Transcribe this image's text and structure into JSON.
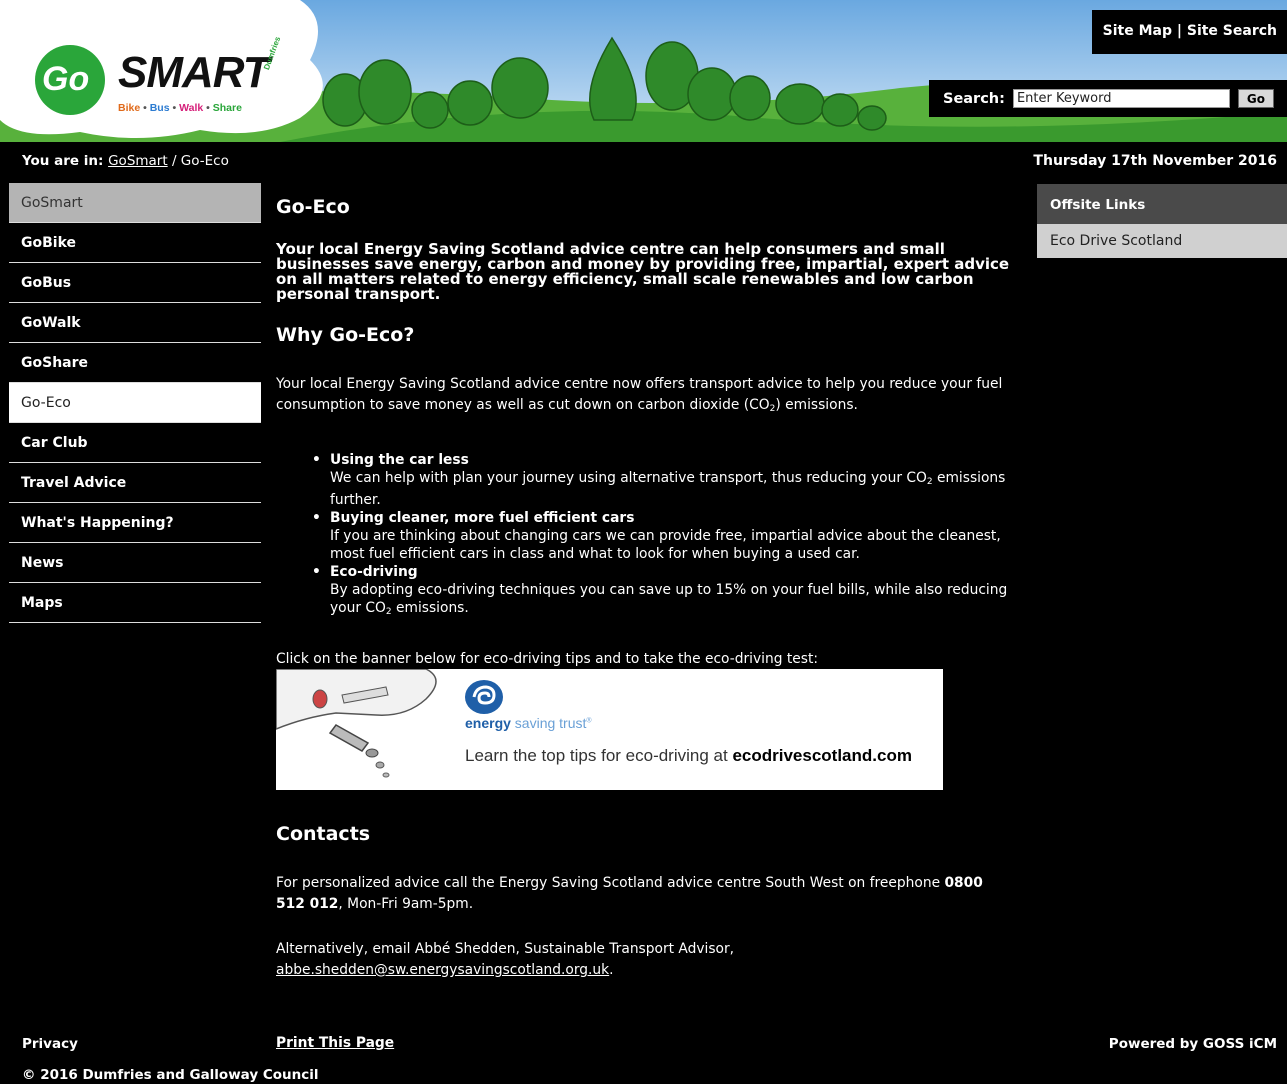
{
  "header": {
    "logo_go": "Go",
    "logo_smart": "SMART",
    "logo_suffix": "Dumfries",
    "logo_tagline_bike": "Bike",
    "logo_tagline_bus": "Bus",
    "logo_tagline_walk": "Walk",
    "logo_tagline_share": "Share",
    "top_links": [
      "Site Map",
      "Site Search"
    ],
    "top_links_sep": " | ",
    "search_label": "Search:",
    "search_placeholder": "Enter Keyword",
    "search_button": "Go"
  },
  "breadcrumb": {
    "prefix": "You are in:",
    "parent": "GoSmart",
    "sep": " / ",
    "current": "Go-Eco"
  },
  "date": "Thursday 17th November 2016",
  "leftnav": [
    "GoSmart",
    "GoBike",
    "GoBus",
    "GoWalk",
    "GoShare",
    "Go-Eco",
    "Car Club",
    "Travel Advice",
    "What's Happening?",
    "News",
    "Maps"
  ],
  "rightcol": {
    "heading": "Offsite Links",
    "links": [
      "Eco Drive Scotland"
    ]
  },
  "main": {
    "title": "Go-Eco",
    "lead": "Your local Energy Saving Scotland advice centre can help consumers and small businesses save energy, carbon and money by providing free, impartial, expert advice on all matters related to energy efficiency, small scale renewables and low carbon personal transport.",
    "why_heading": "Why Go-Eco?",
    "intro_a": "Your local Energy Saving Scotland advice centre now offers transport advice to help you reduce your fuel consumption to save money as well as cut down on carbon dioxide (CO",
    "intro_sub": "2",
    "intro_b": ") emissions.",
    "benefits": [
      {
        "title": "Using the car less",
        "text_a": "We can help with plan your journey using alternative transport, thus reducing your CO",
        "text_sub": "2",
        "text_b": " emissions further."
      },
      {
        "title": "Buying cleaner, more fuel efficient cars",
        "text_a": "If you are thinking about changing cars we can provide free, impartial advice about the cleanest, most fuel efficient cars in class and what to look for when buying a used car.",
        "text_sub": "",
        "text_b": ""
      },
      {
        "title": "Eco-driving",
        "text_a": "By adopting eco-driving techniques you can save up to 15% on your fuel bills, while also reducing your CO",
        "text_sub": "2",
        "text_b": " emissions."
      }
    ],
    "banner_lead": "Click on the banner below for eco-driving tips and to take the eco-driving test:",
    "banner": {
      "brand_bold": "energy",
      "brand_rest": " saving trust",
      "brand_mark": "®",
      "tag_a": "Learn the top tips for eco-driving at ",
      "tag_b": "ecodrivescotland.com"
    },
    "contacts_heading": "Contacts",
    "contact_1a": "For personalized advice call the Energy Saving Scotland advice centre South West on freephone ",
    "contact_phone": "0800 512 012",
    "contact_1b": ", Mon-Fri 9am-5pm.",
    "contact_2a": "Alternatively, email Abbé Shedden, Sustainable Transport Advisor, ",
    "contact_email": "abbe.shedden@sw.energysavingscotland.org.uk",
    "contact_2b": ".",
    "print": "Print This Page"
  },
  "footer": {
    "privacy": "Privacy",
    "powered": "Powered by GOSS iCM",
    "copyright": "© 2016 Dumfries and Galloway Council"
  },
  "colors": {
    "background": "#000000",
    "nav_top": "#b4b4b4",
    "nav_active": "#ffffff",
    "offsite_heading": "#4a4a4a",
    "offsite_link": "#d0d0d0",
    "logo_green": "#2aa63a",
    "sky_blue": "#9fc8ec",
    "hill_green": "#3a9a2e"
  }
}
